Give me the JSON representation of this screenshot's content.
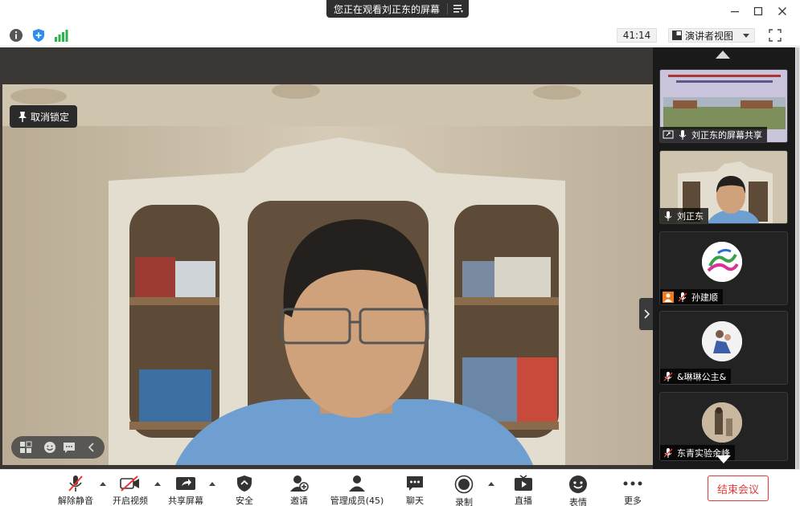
{
  "banner": {
    "text": "您正在观看刘正东的屏幕",
    "menu_icon": "list-icon"
  },
  "window_controls": {
    "minimize": "─",
    "maximize": "☐",
    "close": "✕"
  },
  "infobar": {
    "icons": [
      "info-icon",
      "shield-icon",
      "signal-icon"
    ],
    "timer": "41:14",
    "view_mode": "演讲者视图",
    "fullscreen_icon": "fullscreen-icon"
  },
  "stage": {
    "unlock_label": "取消锁定",
    "speaker": "刘正东"
  },
  "participants": [
    {
      "name": "刘正东的屏幕共享",
      "kind": "screen"
    },
    {
      "name": "刘正东",
      "kind": "video"
    },
    {
      "name": "孙建顺",
      "kind": "avatar"
    },
    {
      "name": "&琳琳公主&",
      "kind": "avatar"
    },
    {
      "name": "东青实验余峰",
      "kind": "avatar"
    }
  ],
  "toolbar": {
    "items": [
      {
        "label": "解除静音",
        "icon": "mic-muted-icon"
      },
      {
        "label": "开启视频",
        "icon": "video-off-icon"
      },
      {
        "label": "共享屏幕",
        "icon": "share-screen-icon"
      },
      {
        "label": "安全",
        "icon": "security-icon"
      },
      {
        "label": "邀请",
        "icon": "invite-icon"
      },
      {
        "label": "管理成员(45)",
        "icon": "participants-icon"
      },
      {
        "label": "聊天",
        "icon": "chat-icon"
      },
      {
        "label": "录制",
        "icon": "record-icon"
      },
      {
        "label": "直播",
        "icon": "live-icon"
      },
      {
        "label": "表情",
        "icon": "emoji-icon"
      },
      {
        "label": "更多",
        "icon": "more-icon"
      }
    ],
    "end_label": "结束会议"
  },
  "colors": {
    "end_red": "#e03a3a",
    "panel_bg": "#1a1a1a",
    "signal_green": "#2bb34a",
    "shield_blue": "#2d8cf0"
  }
}
